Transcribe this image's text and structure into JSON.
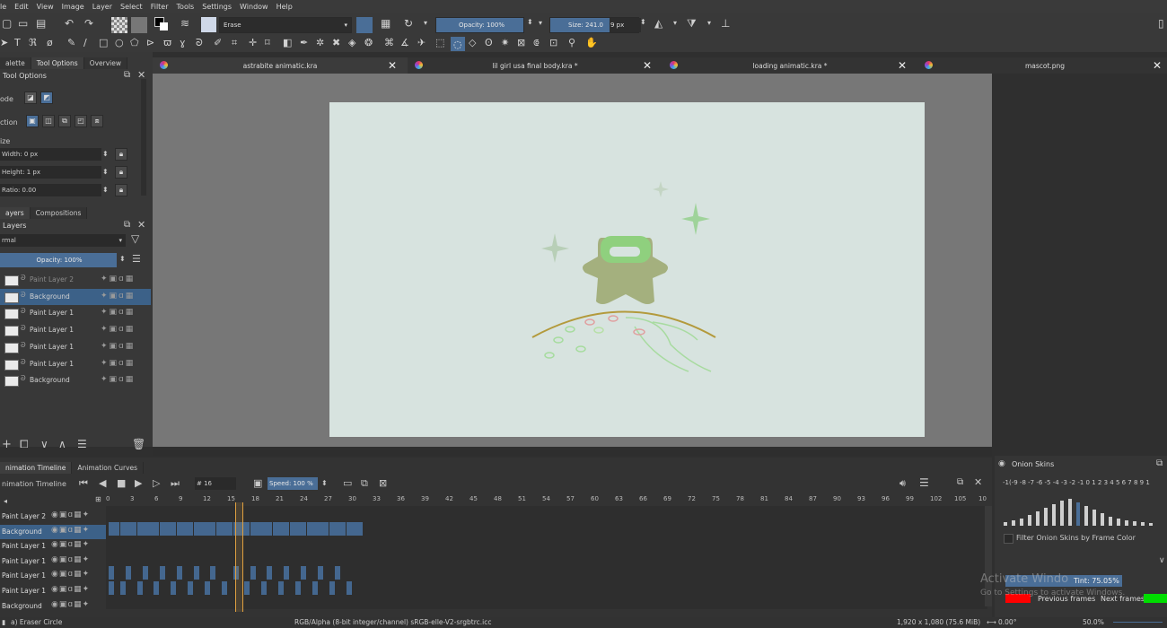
{
  "menu": [
    "le",
    "Edit",
    "View",
    "Image",
    "Layer",
    "Select",
    "Filter",
    "Tools",
    "Settings",
    "Window",
    "Help"
  ],
  "toolbar": {
    "brush_preset": "Erase",
    "opacity": "Opacity: 100%",
    "size_prefix": "Size: 241.0",
    "size_suffix": "9 px"
  },
  "tool_panel": {
    "tabs": [
      "alette",
      "Tool Options",
      "Overview"
    ],
    "title": "Tool Options",
    "mode_label": "ode",
    "action_label": "ction",
    "size_label": "ize",
    "width": "Width: 0 px",
    "height": "Height: 1 px",
    "ratio": "Ratio: 0.00"
  },
  "layers_panel": {
    "tabs": [
      "ayers",
      "Compositions"
    ],
    "title": "Layers",
    "blend_mode": "rmal",
    "opacity": "Opacity:  100%",
    "layers": [
      {
        "name": "Paint Layer 2",
        "selected": false,
        "dim": true
      },
      {
        "name": "Background",
        "selected": true,
        "dim": false
      },
      {
        "name": "Paint Layer 1",
        "selected": false,
        "dim": false
      },
      {
        "name": "Paint Layer 1",
        "selected": false,
        "dim": false
      },
      {
        "name": "Paint Layer 1",
        "selected": false,
        "dim": false
      },
      {
        "name": "Paint Layer 1",
        "selected": false,
        "dim": false
      },
      {
        "name": "Background",
        "selected": false,
        "dim": false
      }
    ]
  },
  "documents": [
    {
      "title": "astrabite animatic.kra"
    },
    {
      "title": "lil girl usa final body.kra *"
    },
    {
      "title": "loading animatic.kra *"
    },
    {
      "title": "mascot.png"
    }
  ],
  "timeline": {
    "tabs": [
      "nimation Timeline",
      "Animation Curves"
    ],
    "title": "nimation Timeline",
    "frame_field": "# 16",
    "speed": "Speed: 100 %",
    "ruler": [
      "0",
      "3",
      "6",
      "9",
      "12",
      "15",
      "18",
      "21",
      "24",
      "27",
      "30",
      "33",
      "36",
      "39",
      "42",
      "45",
      "48",
      "51",
      "54",
      "57",
      "60",
      "63",
      "66",
      "69",
      "72",
      "75",
      "78",
      "81",
      "84",
      "87",
      "90",
      "93",
      "96",
      "99",
      "102",
      "105",
      "10"
    ],
    "rows": [
      "Paint Layer 2",
      "Background",
      "Paint Layer 1",
      "Paint Layer 1",
      "Paint Layer 1",
      "Paint Layer 1",
      "Background"
    ]
  },
  "onion": {
    "title": "Onion Skins",
    "numbers": "-1(-9 -8 -7 -6 -5 -4 -3 -2 -1  0  1 2 3 4 5 6 7 8 9 1",
    "filter_label": "Filter Onion Skins by Frame Color",
    "tint": "Tint: 75.05%",
    "prev": "Previous frames",
    "next": "Next frames",
    "watermark1": "Activate Windo",
    "watermark2": "Go to Settings to activate Windows."
  },
  "status": {
    "tool": "a) Eraser Circle",
    "color": "RGB/Alpha (8-bit integer/channel)  sRGB-elle-V2-srgbtrc.icc",
    "dims": "1,920 x 1,080 (75.6 MiB)",
    "angle": "0.00°",
    "zoom": "50.0%"
  }
}
